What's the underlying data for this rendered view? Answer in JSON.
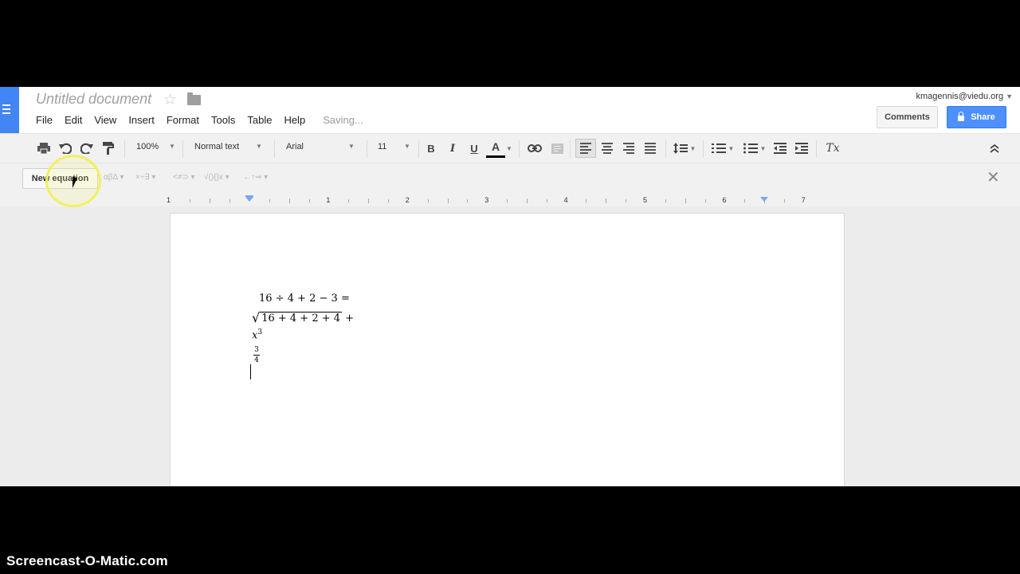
{
  "document": {
    "title": "Untitled document"
  },
  "menu": {
    "items": [
      "File",
      "Edit",
      "View",
      "Insert",
      "Format",
      "Tools",
      "Table",
      "Help"
    ],
    "status": "Saving..."
  },
  "user": {
    "email": "kmagennis@viedu.org"
  },
  "buttons": {
    "comments": "Comments",
    "share": "Share"
  },
  "toolbar": {
    "zoom": "100%",
    "style": "Normal text",
    "font": "Arial",
    "font_size": "11",
    "bold": "B",
    "italic": "I",
    "underline": "U",
    "text_color_glyph": "A",
    "clear_format": "Tx",
    "icons": [
      "print-icon",
      "undo-icon",
      "redo-icon",
      "paint-format-icon",
      "link-icon",
      "comment-icon",
      "align-left-icon",
      "align-center-icon",
      "align-right-icon",
      "justify-icon",
      "line-spacing-icon",
      "numbered-list-icon",
      "bulleted-list-icon",
      "decrease-indent-icon",
      "increase-indent-icon",
      "collapse-icon"
    ]
  },
  "equation_toolbar": {
    "new_equation": "New equation",
    "groups": [
      "αβΔ",
      "×÷∃",
      "<≠⊃",
      "√(){}x",
      "←↑⇒"
    ]
  },
  "ruler": {
    "numbers": [
      "1",
      "1",
      "2",
      "3",
      "4",
      "5",
      "6",
      "7"
    ]
  },
  "equations": {
    "line1": "16 ÷ 4 + 2 − 3 =",
    "line2_radicand": "16 + 4 + 2 + 4",
    "line2_suffix": " +",
    "line3_base": "x",
    "line3_exp": "3",
    "line4_num": "3",
    "line4_den": "4"
  },
  "watermark": "Screencast-O-Matic.com",
  "colors": {
    "accent_blue": "#4d90fe",
    "docs_blue": "#4285f4",
    "highlight_yellow": "#f2f060",
    "ruler_marker": "#7ba7e9"
  }
}
